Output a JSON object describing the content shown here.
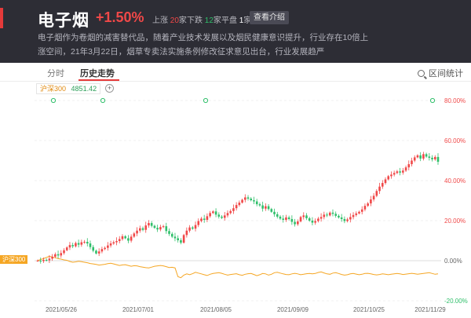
{
  "header": {
    "title": "电子烟",
    "change": "+1.50%",
    "up_label": "上涨",
    "up_count": "20",
    "down_label": "下跌",
    "down_count": "12",
    "flat_label": "平盘",
    "flat_count": "1",
    "count_unit": "家",
    "intro_button": "查看介绍",
    "description": "电子烟作为卷烟的减害替代品，随着产业技术发展以及烟民健康意识提升，行业存在10倍上涨空间，21年3月22日，烟草专卖法实施条例修改征求意见出台，行业发展趋严"
  },
  "tabs": {
    "fenshi": "分时",
    "history": "历史走势",
    "range_stats": "区间统计"
  },
  "index": {
    "name": "沪深300",
    "value": "4851.42",
    "add_symbol": "+"
  },
  "legend_tag": "沪深300",
  "colors": {
    "up": "#f04848",
    "down": "#2fbf6a",
    "benchmark": "#f5a623",
    "accent": "#e53a3a"
  },
  "chart_data": {
    "type": "line",
    "ylim": [
      -20,
      80
    ],
    "yticks": [
      "80.00%",
      "60.00%",
      "40.00%",
      "20.00%",
      "0.00%",
      "-20.00%"
    ],
    "ytick_values": [
      80,
      60,
      40,
      20,
      0,
      -20
    ],
    "xticks": [
      "2021/05/26",
      "2021/07/01",
      "2021/08/05",
      "2021/09/09",
      "2021/10/25",
      "2021/11/29"
    ],
    "series": [
      {
        "name": "沪深300",
        "values": [
          0.0,
          0.6,
          1.0,
          1.6,
          2.2,
          1.8,
          1.5,
          1.0,
          0.8,
          0.4,
          0.2,
          -0.4,
          -0.8,
          -0.6,
          -0.3,
          -0.5,
          -0.8,
          -1.0,
          -1.4,
          -1.6,
          -1.9,
          -2.2,
          -2.0,
          -1.8,
          -1.5,
          -1.3,
          -1.6,
          -2.0,
          -2.4,
          -2.1,
          -2.0,
          -2.4,
          -2.8,
          -2.5,
          -2.6,
          -3.0,
          -3.2,
          -3.5,
          -3.6,
          -3.2,
          -2.8,
          -2.6,
          -2.4,
          -2.6,
          -3.0,
          -3.4,
          -3.3,
          -3.6,
          -8.0,
          -8.5,
          -7.2,
          -6.6,
          -7.0,
          -6.5,
          -5.8,
          -6.2,
          -6.6,
          -7.0,
          -7.4,
          -6.8,
          -6.4,
          -6.2,
          -6.0,
          -6.3,
          -6.8,
          -7.2,
          -6.9,
          -6.7,
          -6.5,
          -7.0,
          -7.3,
          -6.8,
          -6.5,
          -6.4,
          -6.9,
          -7.5,
          -7.0,
          -6.4,
          -6.6,
          -7.2,
          -6.8,
          -6.0,
          -5.8,
          -6.2,
          -6.6,
          -6.9,
          -7.0,
          -6.6,
          -6.3,
          -6.6,
          -7.0,
          -6.8,
          -6.5,
          -6.4,
          -6.6,
          -6.4,
          -5.9,
          -5.6,
          -6.1,
          -6.6,
          -6.8,
          -6.2,
          -6.0,
          -6.4,
          -6.9,
          -7.2,
          -7.0,
          -6.6,
          -6.4,
          -6.7,
          -7.0,
          -6.8,
          -6.4,
          -6.3,
          -6.6,
          -6.9,
          -7.1,
          -6.9,
          -6.6,
          -6.8,
          -7.0,
          -6.8,
          -6.6,
          -6.4,
          -6.6,
          -6.9,
          -6.7,
          -6.5,
          -6.3,
          -6.5,
          -6.8,
          -6.6,
          -6.4,
          -6.2,
          -6.0,
          -6.4,
          -6.8,
          -6.6
        ]
      },
      {
        "name": "电子烟",
        "values": [
          0.0,
          -0.2,
          0.4,
          0.2,
          1.0,
          2.0,
          3.2,
          2.6,
          3.8,
          5.2,
          6.6,
          7.8,
          7.2,
          8.8,
          8.0,
          9.2,
          9.4,
          8.6,
          6.8,
          5.0,
          3.6,
          4.6,
          5.8,
          6.4,
          7.6,
          8.6,
          9.2,
          9.8,
          10.8,
          12.2,
          11.2,
          10.0,
          12.0,
          13.6,
          15.0,
          16.2,
          15.4,
          17.6,
          18.8,
          17.4,
          16.4,
          15.6,
          16.8,
          17.2,
          14.8,
          13.4,
          12.0,
          11.2,
          10.2,
          9.0,
          12.8,
          15.0,
          16.6,
          16.0,
          17.8,
          19.8,
          21.0,
          20.4,
          22.2,
          23.8,
          24.6,
          23.0,
          22.0,
          21.4,
          22.6,
          23.8,
          24.8,
          26.2,
          27.8,
          29.0,
          30.4,
          31.6,
          31.0,
          30.2,
          29.6,
          28.2,
          27.6,
          26.0,
          27.2,
          25.8,
          24.4,
          23.2,
          22.0,
          21.0,
          20.4,
          21.6,
          20.8,
          19.4,
          18.2,
          19.6,
          21.8,
          22.6,
          21.2,
          20.0,
          19.0,
          19.8,
          21.0,
          21.8,
          23.0,
          22.6,
          24.0,
          23.4,
          22.4,
          21.6,
          20.8,
          19.8,
          20.6,
          21.8,
          22.8,
          23.6,
          24.4,
          25.6,
          27.4,
          28.6,
          30.6,
          32.4,
          34.8,
          37.0,
          38.8,
          40.6,
          42.2,
          43.0,
          43.8,
          44.6,
          44.0,
          45.0,
          46.6,
          48.2,
          50.0,
          51.6,
          52.6,
          51.0,
          53.2,
          52.0,
          51.4,
          50.6,
          51.8,
          49.4
        ]
      }
    ]
  }
}
